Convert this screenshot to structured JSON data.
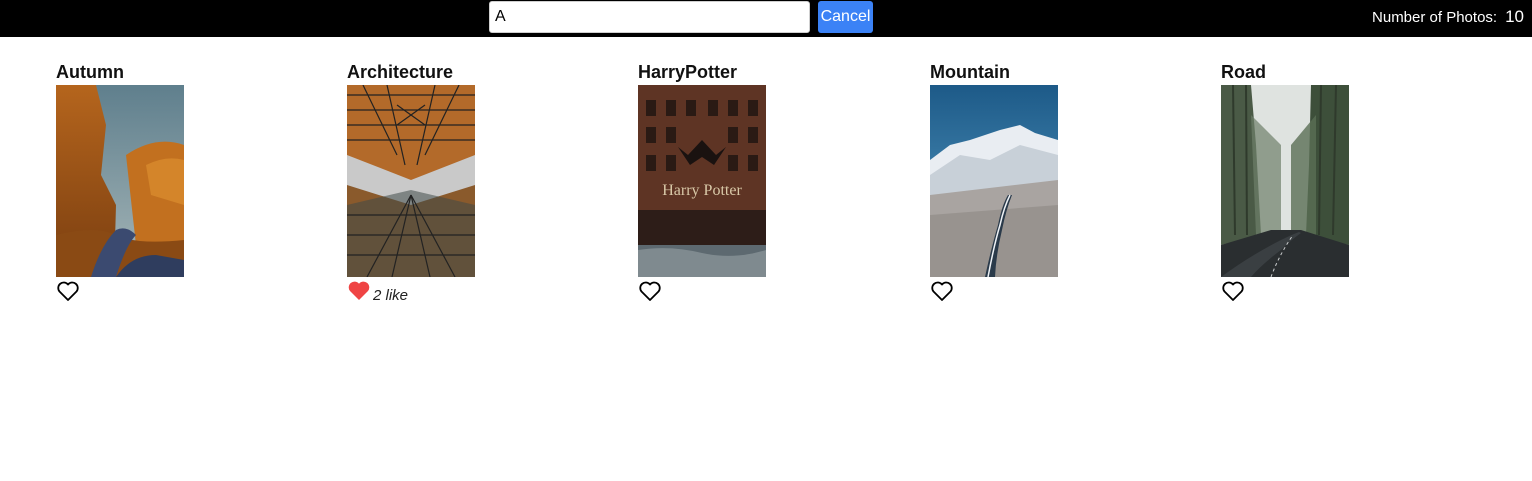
{
  "header": {
    "search_value": "A",
    "cancel_label": "Cancel",
    "count_label": "Number of Photos:",
    "count_value": "10",
    "cancel_color": "#3b82f6"
  },
  "photos": [
    {
      "title": "Autumn",
      "liked": false,
      "like_text": ""
    },
    {
      "title": "Architecture",
      "liked": true,
      "like_text": "2 like"
    },
    {
      "title": "HarryPotter",
      "liked": false,
      "like_text": ""
    },
    {
      "title": "Mountain",
      "liked": false,
      "like_text": ""
    },
    {
      "title": "Road",
      "liked": false,
      "like_text": ""
    }
  ],
  "image_overlays": {
    "harrypotter_sign": "Harry Potter"
  },
  "colors": {
    "heart_liked": "#ef4444",
    "heart_outline": "#000000"
  },
  "icons": {
    "like": "heart-icon"
  }
}
